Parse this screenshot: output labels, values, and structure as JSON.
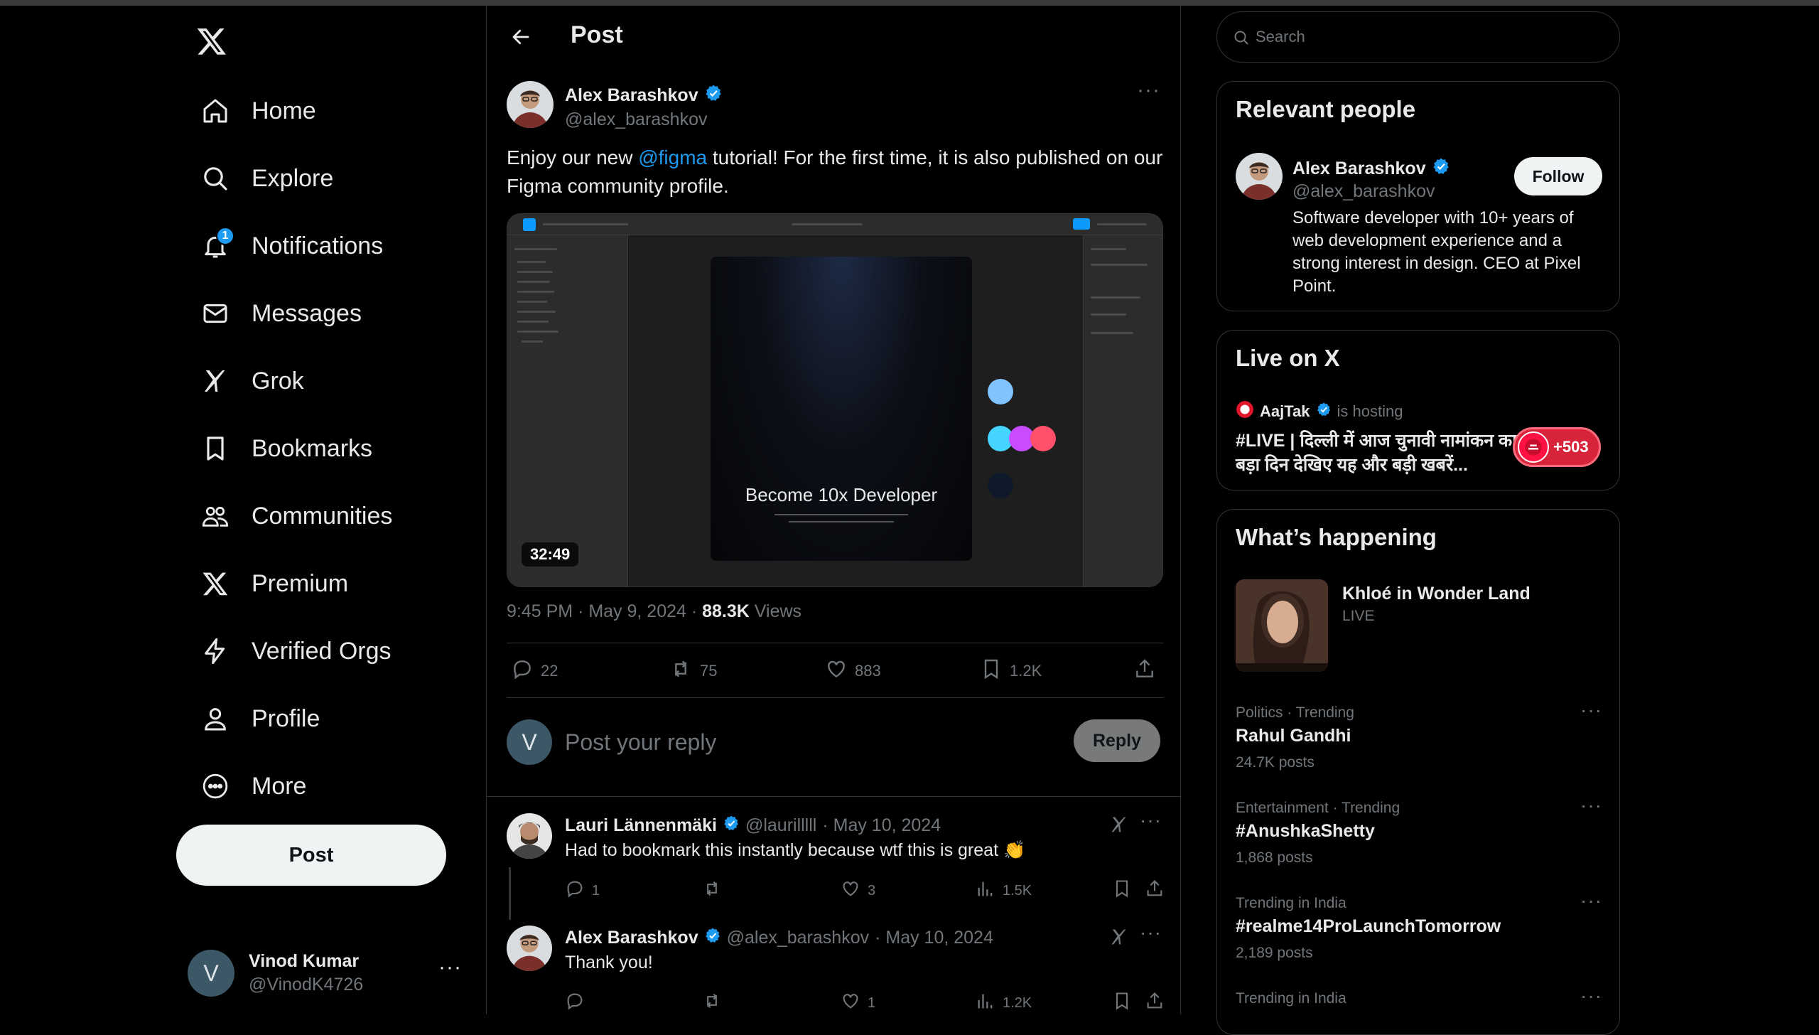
{
  "nav": {
    "items": [
      {
        "label": "Home"
      },
      {
        "label": "Explore"
      },
      {
        "label": "Notifications",
        "badge": "1"
      },
      {
        "label": "Messages"
      },
      {
        "label": "Grok"
      },
      {
        "label": "Bookmarks"
      },
      {
        "label": "Communities"
      },
      {
        "label": "Premium"
      },
      {
        "label": "Verified Orgs"
      },
      {
        "label": "Profile"
      },
      {
        "label": "More"
      }
    ],
    "post_button": "Post",
    "account": {
      "avatar_initial": "V",
      "name": "Vinod Kumar",
      "handle": "@VinodK4726",
      "more": "···"
    }
  },
  "header": {
    "title": "Post"
  },
  "post": {
    "author_name": "Alex Barashkov",
    "author_handle": "@alex_barashkov",
    "more": "···",
    "text_before": "Enjoy our new ",
    "mention": "@figma",
    "text_after": " tutorial! For the first time, it is also published on our Figma community profile.",
    "video": {
      "frame_title": "Become 10x Developer",
      "duration": "32:49"
    },
    "timestamp": "9:45 PM · May 9, 2024 · ",
    "views_count": "88.3K",
    "views_label": " Views",
    "stats": {
      "replies": "22",
      "reposts": "75",
      "likes": "883",
      "bookmarks": "1.2K"
    }
  },
  "reply_box": {
    "avatar_initial": "V",
    "placeholder": "Post your reply",
    "button": "Reply"
  },
  "comments": [
    {
      "name": "Lauri Lännenmäki",
      "handle": "@laurilllll",
      "date": "· May 10, 2024",
      "text": "Had to bookmark this instantly because wtf this is great 👏",
      "replies": "1",
      "likes": "3",
      "views": "1.5K"
    },
    {
      "name": "Alex Barashkov",
      "handle": "@alex_barashkov",
      "date": "· May 10, 2024",
      "text": "Thank you!",
      "replies": "",
      "likes": "1",
      "views": "1.2K"
    }
  ],
  "search": {
    "placeholder": "Search"
  },
  "relevant": {
    "title": "Relevant people",
    "name": "Alex Barashkov",
    "handle": "@alex_barashkov",
    "follow": "Follow",
    "bio": "Software developer with 10+ years of web development experience and a strong interest in design. CEO at Pixel Point."
  },
  "live": {
    "title": "Live on X",
    "host": "AajTak",
    "status": "is hosting",
    "text": "#LIVE | दिल्ली में आज चुनावी नामांकन का बड़ा दिन  देखिए यह और बड़ी खबरें...",
    "count": "+503"
  },
  "happening": {
    "title": "What’s happening",
    "featured": {
      "title": "Khloé in Wonder Land",
      "sub": "LIVE"
    },
    "trends": [
      {
        "context": "Politics · Trending",
        "title": "Rahul Gandhi",
        "count": "24.7K posts"
      },
      {
        "context": "Entertainment · Trending",
        "title": "#AnushkaShetty",
        "count": "1,868 posts"
      },
      {
        "context": "Trending in India",
        "title": "#realme14ProLaunchTomorrow",
        "count": "2,189 posts"
      },
      {
        "context": "Trending in India",
        "title": "",
        "count": ""
      }
    ]
  },
  "colors": {
    "accent": "#1d9bf0",
    "background": "#000000",
    "border": "#2f3336",
    "muted": "#71767b"
  }
}
